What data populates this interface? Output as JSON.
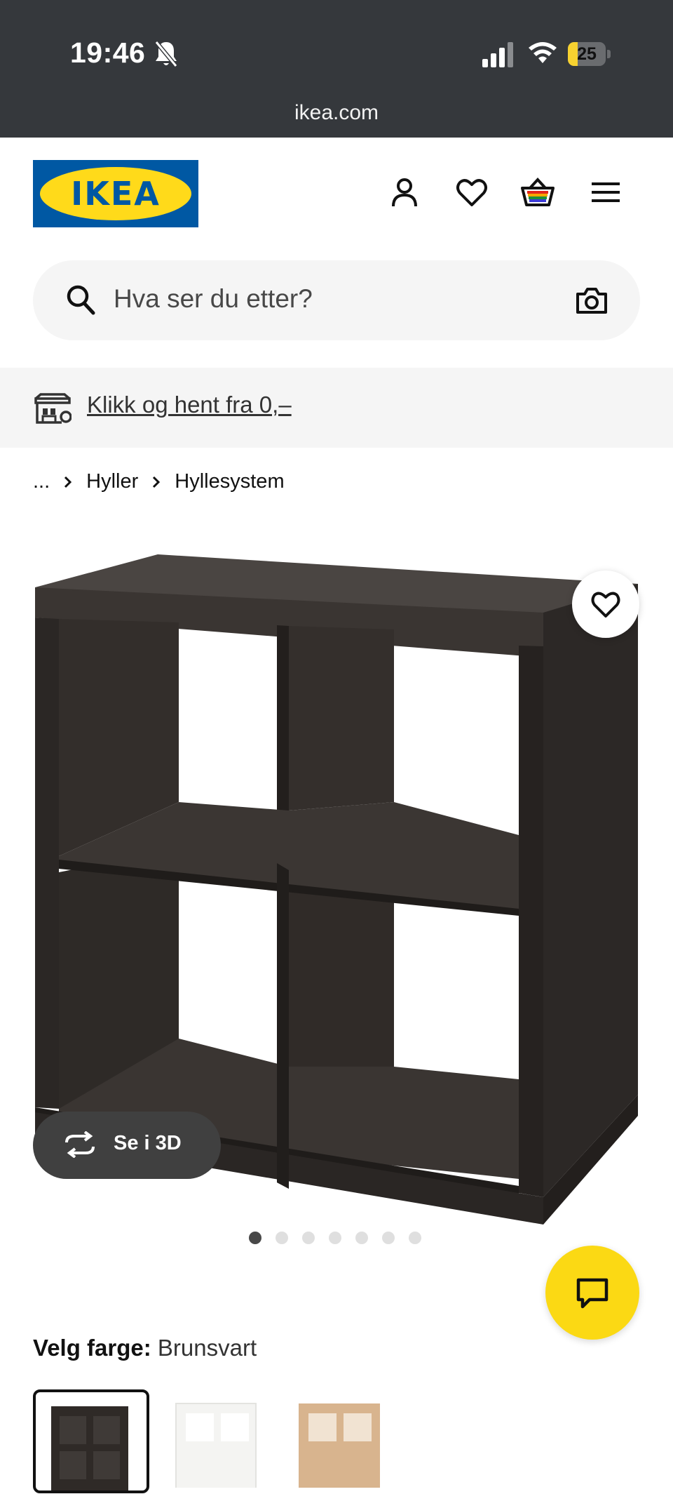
{
  "status_bar": {
    "time": "19:46",
    "battery_level": "25",
    "url": "ikea.com"
  },
  "header": {
    "logo_text": "IKEA",
    "icons": [
      "account-icon",
      "wishlist-icon",
      "cart-icon",
      "menu-icon"
    ]
  },
  "search": {
    "placeholder": "Hva ser du etter?"
  },
  "promo": {
    "link_text": "Klikk og hent fra 0,–"
  },
  "breadcrumb": {
    "ellipsis": "...",
    "items": [
      "Hyller",
      "Hyllesystem"
    ]
  },
  "product": {
    "view_3d_label": "Se i 3D",
    "image_count": 7,
    "active_image_index": 0,
    "color_label": "Velg farge:",
    "color_value": "Brunsvart",
    "swatches": [
      "Brunsvart",
      "Hvit",
      "Eikeffekt"
    ]
  },
  "colors": {
    "status_bar_bg": "#35383c",
    "ikea_blue": "#0058a3",
    "ikea_yellow": "#ffda1a",
    "chat_yellow": "#fbd914",
    "product_dark": "#2f2a27"
  }
}
